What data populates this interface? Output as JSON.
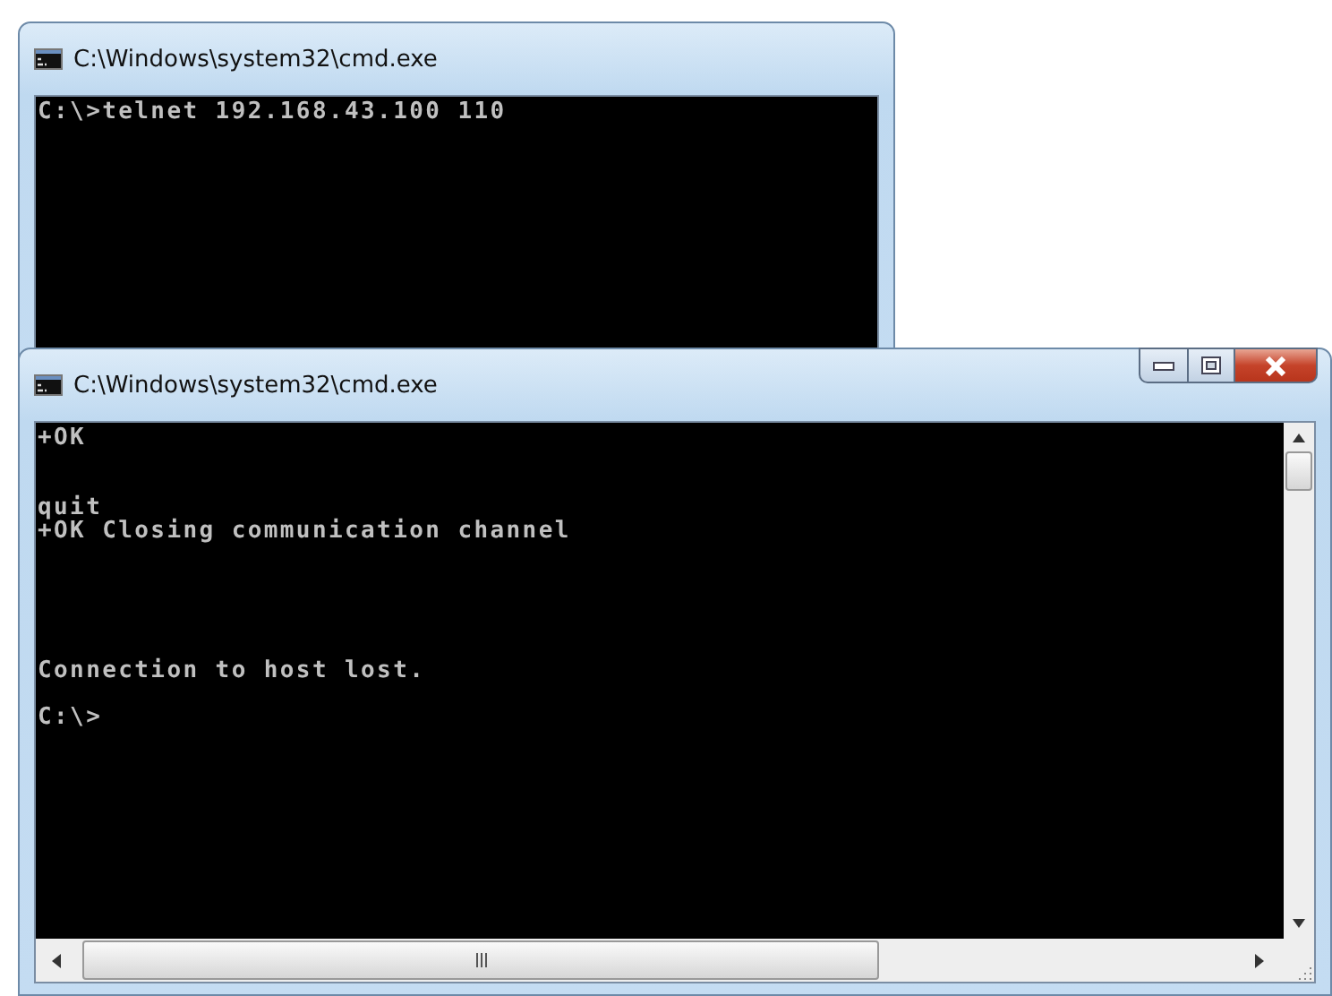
{
  "windows": [
    {
      "title": "C:\\Windows\\system32\\cmd.exe",
      "has_controls": false,
      "scrollbars": false,
      "output": "C:\\>telnet 192.168.43.100 110"
    },
    {
      "title": "C:\\Windows\\system32\\cmd.exe",
      "has_controls": true,
      "scrollbars": true,
      "output": "+OK\n\n\nquit\n+OK Closing communication channel\n\n\n\n\n\nConnection to host lost.\n\nC:\\>"
    }
  ]
}
